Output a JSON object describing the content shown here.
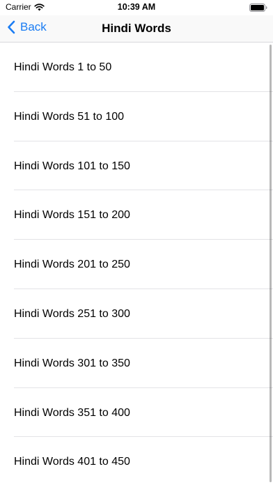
{
  "status_bar": {
    "carrier": "Carrier",
    "time": "10:39 AM",
    "wifi_icon": "wifi-icon",
    "battery_icon": "battery-icon"
  },
  "nav": {
    "back_label": "Back",
    "back_icon": "chevron-left-icon",
    "title": "Hindi Words"
  },
  "colors": {
    "accent": "#1a7cf3",
    "separator": "#e3e3e6",
    "nav_background": "#f9f9f9"
  },
  "list": {
    "items": [
      {
        "label": "Hindi Words 1 to 50"
      },
      {
        "label": "Hindi Words 51 to 100"
      },
      {
        "label": "Hindi Words 101 to 150"
      },
      {
        "label": "Hindi Words 151 to 200"
      },
      {
        "label": "Hindi Words 201 to 250"
      },
      {
        "label": "Hindi Words 251 to 300"
      },
      {
        "label": "Hindi Words 301 to 350"
      },
      {
        "label": "Hindi Words 351 to 400"
      },
      {
        "label": "Hindi Words 401 to 450"
      }
    ]
  }
}
